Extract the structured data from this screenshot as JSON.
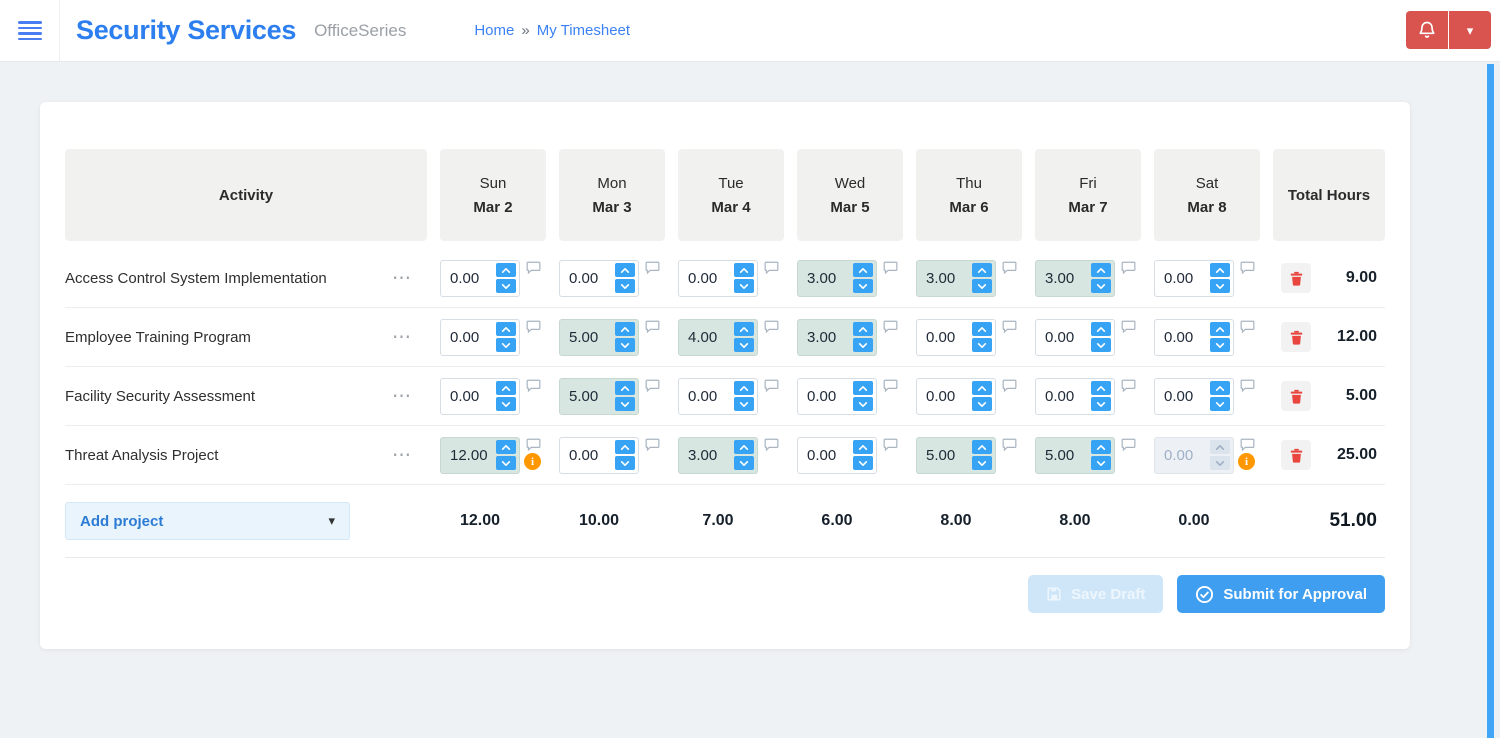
{
  "header": {
    "app_title": "Security Services",
    "suite_name": "OfficeSeries",
    "breadcrumb": {
      "home": "Home",
      "separator": "»",
      "current": "My Timesheet"
    }
  },
  "icons": {
    "ellipsis": "⋯",
    "caret_down": "▾",
    "info": "i"
  },
  "colors": {
    "accent_blue": "#2d7ff0",
    "spinner_blue": "#36a3f5",
    "danger_red": "#d9534f",
    "filled_cell_bg": "#d7e6e0",
    "warning_orange": "#ff9800",
    "scrollbar_blue": "#42a5f5"
  },
  "timesheet": {
    "columns": {
      "activity_label": "Activity",
      "days": [
        {
          "day": "Sun",
          "date": "Mar 2"
        },
        {
          "day": "Mon",
          "date": "Mar 3"
        },
        {
          "day": "Tue",
          "date": "Mar 4"
        },
        {
          "day": "Wed",
          "date": "Mar 5"
        },
        {
          "day": "Thu",
          "date": "Mar 6"
        },
        {
          "day": "Fri",
          "date": "Mar 7"
        },
        {
          "day": "Sat",
          "date": "Mar 8"
        }
      ],
      "total_label": "Total Hours"
    },
    "rows": [
      {
        "activity": "Access Control System Implementation",
        "cells": [
          {
            "value": "0.00",
            "state": "empty",
            "warning": false
          },
          {
            "value": "0.00",
            "state": "empty",
            "warning": false
          },
          {
            "value": "0.00",
            "state": "empty",
            "warning": false
          },
          {
            "value": "3.00",
            "state": "filled",
            "warning": false
          },
          {
            "value": "3.00",
            "state": "filled",
            "warning": false
          },
          {
            "value": "3.00",
            "state": "filled",
            "warning": false
          },
          {
            "value": "0.00",
            "state": "empty",
            "warning": false
          }
        ],
        "total": "9.00"
      },
      {
        "activity": "Employee Training Program",
        "cells": [
          {
            "value": "0.00",
            "state": "empty",
            "warning": false
          },
          {
            "value": "5.00",
            "state": "filled",
            "warning": false
          },
          {
            "value": "4.00",
            "state": "filled",
            "warning": false
          },
          {
            "value": "3.00",
            "state": "filled",
            "warning": false
          },
          {
            "value": "0.00",
            "state": "empty",
            "warning": false
          },
          {
            "value": "0.00",
            "state": "empty",
            "warning": false
          },
          {
            "value": "0.00",
            "state": "empty",
            "warning": false
          }
        ],
        "total": "12.00"
      },
      {
        "activity": "Facility Security Assessment",
        "cells": [
          {
            "value": "0.00",
            "state": "empty",
            "warning": false
          },
          {
            "value": "5.00",
            "state": "filled",
            "warning": false
          },
          {
            "value": "0.00",
            "state": "empty",
            "warning": false
          },
          {
            "value": "0.00",
            "state": "empty",
            "warning": false
          },
          {
            "value": "0.00",
            "state": "empty",
            "warning": false
          },
          {
            "value": "0.00",
            "state": "empty",
            "warning": false
          },
          {
            "value": "0.00",
            "state": "empty",
            "warning": false
          }
        ],
        "total": "5.00"
      },
      {
        "activity": "Threat Analysis Project",
        "cells": [
          {
            "value": "12.00",
            "state": "filled",
            "warning": true
          },
          {
            "value": "0.00",
            "state": "empty",
            "warning": false
          },
          {
            "value": "3.00",
            "state": "filled",
            "warning": false
          },
          {
            "value": "0.00",
            "state": "empty",
            "warning": false
          },
          {
            "value": "5.00",
            "state": "filled",
            "warning": false
          },
          {
            "value": "5.00",
            "state": "filled",
            "warning": false
          },
          {
            "value": "0.00",
            "state": "disabled",
            "warning": true
          }
        ],
        "total": "25.00"
      }
    ],
    "footer": {
      "add_project_label": "Add project",
      "day_totals": [
        "12.00",
        "10.00",
        "7.00",
        "6.00",
        "8.00",
        "8.00",
        "0.00"
      ],
      "grand_total": "51.00"
    },
    "actions": {
      "save_draft_label": "Save Draft",
      "submit_label": "Submit for Approval"
    }
  }
}
